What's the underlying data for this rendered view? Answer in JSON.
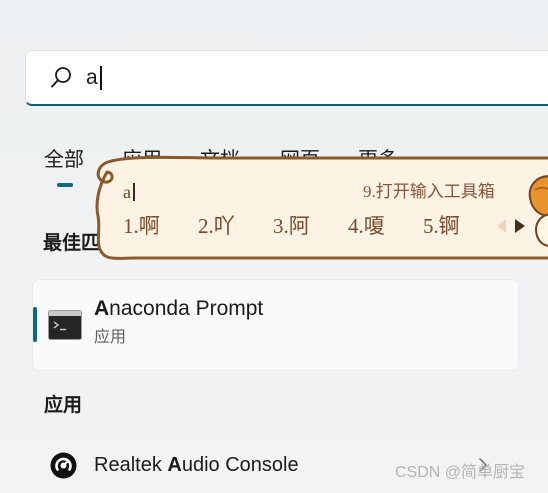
{
  "window": {
    "background": "#f0f2f4",
    "accent": "#0e6a7a"
  },
  "search": {
    "query": "a",
    "icon": "search-icon"
  },
  "tabs": [
    {
      "label": "全部",
      "active": true
    },
    {
      "label": "应用",
      "active": false
    },
    {
      "label": "文档",
      "active": false
    },
    {
      "label": "网页",
      "active": false
    },
    {
      "label": "更多",
      "active": false
    }
  ],
  "best_match": {
    "heading": "最佳匹配",
    "result": {
      "title_match": "A",
      "title_rest": "naconda Prompt",
      "type": "应用",
      "icon": "terminal-icon",
      "selected": true
    }
  },
  "apps": {
    "heading": "应用",
    "items": [
      {
        "title_before": "Realtek ",
        "title_match": "A",
        "title_rest": "udio Console",
        "icon": "audio-console-icon",
        "has_chevron": true
      }
    ]
  },
  "ime": {
    "composition": "a",
    "toolbox_label": "9.打开输入工具箱",
    "candidates": [
      "1.啊",
      "2.吖",
      "3.阿",
      "4.嗄",
      "5.锕"
    ],
    "prev_page_enabled": false,
    "next_page_enabled": true,
    "text_color": "#7b4a2b",
    "border_color": "#8a5a2e",
    "fill_color": "#fdf3e4"
  },
  "watermark": "CSDN @简单厨宝"
}
